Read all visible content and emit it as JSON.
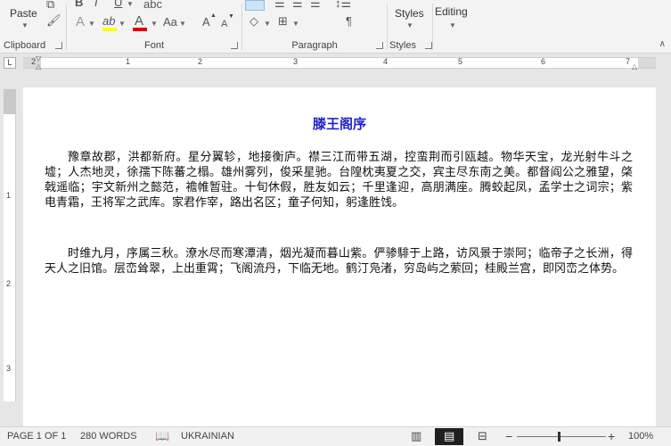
{
  "ribbon": {
    "clipboard": {
      "label": "Clipboard",
      "paste": "Paste"
    },
    "font": {
      "label": "Font",
      "bold": "B",
      "italic": "I",
      "underline": "U",
      "text_effects": "A",
      "highlight": "ab",
      "font_color": "A",
      "change_case": "Aa",
      "grow": "A",
      "shrink": "A"
    },
    "paragraph": {
      "label": "Paragraph",
      "pilcrow": "¶"
    },
    "styles": {
      "label": "Styles",
      "button": "Styles"
    },
    "editing": {
      "button": "Editing"
    },
    "colors": {
      "highlight": "#ffff00",
      "font_color": "#e00000"
    }
  },
  "ruler": {
    "tab_selector": "L",
    "numbers": [
      "2",
      "1",
      "1",
      "2",
      "3",
      "4",
      "5",
      "6",
      "7"
    ],
    "vertical_numbers": [
      "1",
      "2",
      "3"
    ]
  },
  "document": {
    "title": "滕王阁序",
    "title_color": "#1f1fd0",
    "paragraphs": [
      "豫章故郡，洪都新府。星分翼轸，地接衡庐。襟三江而带五湖，控蛮荆而引瓯越。物华天宝，龙光射牛斗之墟；人杰地灵，徐孺下陈蕃之榻。雄州雾列，俊采星驰。台隍枕夷夏之交，宾主尽东南之美。都督阎公之雅望，棨戟遥临；宇文新州之懿范，襜帷暂驻。十旬休假，胜友如云；千里逢迎，高朋满座。腾蛟起凤，孟学士之词宗；紫电青霜，王将军之武库。家君作宰，路出名区；童子何知，躬逢胜饯。",
      "时维九月，序属三秋。潦水尽而寒潭清，烟光凝而暮山紫。俨骖騑于上路，访风景于崇阿；临帝子之长洲，得天人之旧馆。层峦耸翠，上出重霄；飞阁流丹，下临无地。鹤汀凫渚，穷岛屿之萦回；桂殿兰宫，即冈峦之体势。"
    ]
  },
  "status_bar": {
    "page": "PAGE 1 OF 1",
    "words": "280 WORDS",
    "language": "UKRAINIAN",
    "zoom_minus": "−",
    "zoom_plus": "+",
    "zoom": "100%"
  }
}
